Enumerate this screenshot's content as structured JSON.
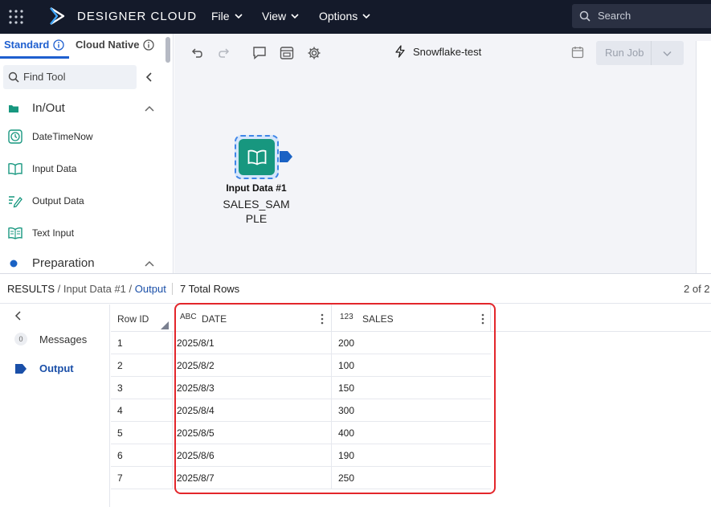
{
  "topbar": {
    "brand": "DESIGNER CLOUD",
    "menus": [
      {
        "label": "File"
      },
      {
        "label": "View"
      },
      {
        "label": "Options"
      }
    ],
    "search_placeholder": "Search"
  },
  "palette": {
    "tabs": [
      {
        "label": "Standard"
      },
      {
        "label": "Cloud Native"
      }
    ],
    "find_placeholder": "Find Tool",
    "categories": [
      {
        "label": "In/Out"
      },
      {
        "label": "Preparation"
      }
    ],
    "tools": [
      {
        "label": "DateTimeNow",
        "icon": "clock-icon"
      },
      {
        "label": "Input Data",
        "icon": "book-icon"
      },
      {
        "label": "Output Data",
        "icon": "pencil-lines-icon"
      },
      {
        "label": "Text Input",
        "icon": "text-book-icon"
      }
    ]
  },
  "canvas": {
    "workflow_name": "Snowflake-test",
    "run_job_label": "Run Job",
    "node": {
      "title": "Input Data #1",
      "subtitle_line1": "SALES_SAM",
      "subtitle_line2": "PLE"
    }
  },
  "results": {
    "breadcrumb": {
      "root": "RESULTS",
      "node": "Input Data #1",
      "current": "Output"
    },
    "total_rows": "7 Total Rows",
    "pager": "2 of 2",
    "side_items": [
      {
        "label": "Messages",
        "badge": "0"
      },
      {
        "label": "Output"
      }
    ],
    "columns": {
      "row_id": "Row ID",
      "date": {
        "label": "DATE",
        "type_glyph": "ABC"
      },
      "sales": {
        "label": "SALES",
        "type_glyph": "123"
      }
    },
    "rows": [
      {
        "id": "1",
        "date": "2025/8/1",
        "sales": "200"
      },
      {
        "id": "2",
        "date": "2025/8/2",
        "sales": "100"
      },
      {
        "id": "3",
        "date": "2025/8/3",
        "sales": "150"
      },
      {
        "id": "4",
        "date": "2025/8/4",
        "sales": "300"
      },
      {
        "id": "5",
        "date": "2025/8/5",
        "sales": "400"
      },
      {
        "id": "6",
        "date": "2025/8/6",
        "sales": "190"
      },
      {
        "id": "7",
        "date": "2025/8/7",
        "sales": "250"
      }
    ]
  },
  "colors": {
    "topbar": "#141a2a",
    "accent": "#1e5fcf",
    "node_teal": "#17977f",
    "highlight": "#e3262b"
  }
}
